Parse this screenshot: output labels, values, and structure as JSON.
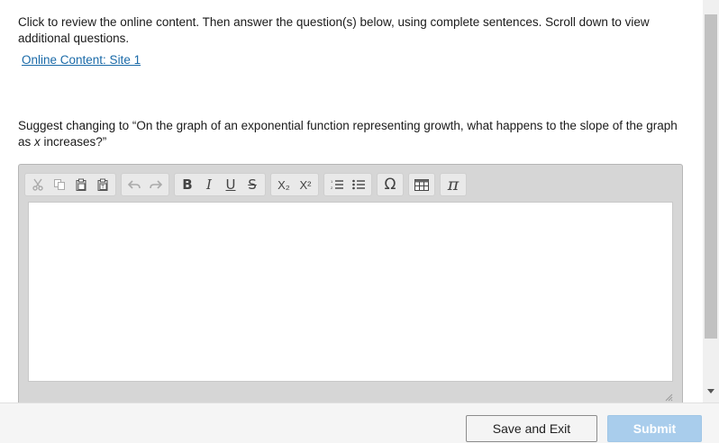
{
  "instructions": "Click to review the online content. Then answer the question(s) below, using complete sentences. Scroll down to view additional questions.",
  "link_label": "Online Content: Site 1",
  "question": {
    "text_before": "Suggest changing to “On the graph of an exponential function representing growth, what happens to the slope of the graph as ",
    "variable": "x",
    "text_after": " increases?”"
  },
  "toolbar": {
    "bold": "B",
    "italic": "I",
    "underline": "U",
    "strike": "S",
    "subscript": "X₂",
    "superscript": "X²",
    "special_char": "Ω",
    "pi": "π"
  },
  "footer": {
    "save_exit_label": "Save and Exit",
    "submit_label": "Submit"
  },
  "colors": {
    "link": "#1a6aa8",
    "submit_bg": "#a9cdec",
    "toolbar_bg": "#d6d6d6"
  }
}
